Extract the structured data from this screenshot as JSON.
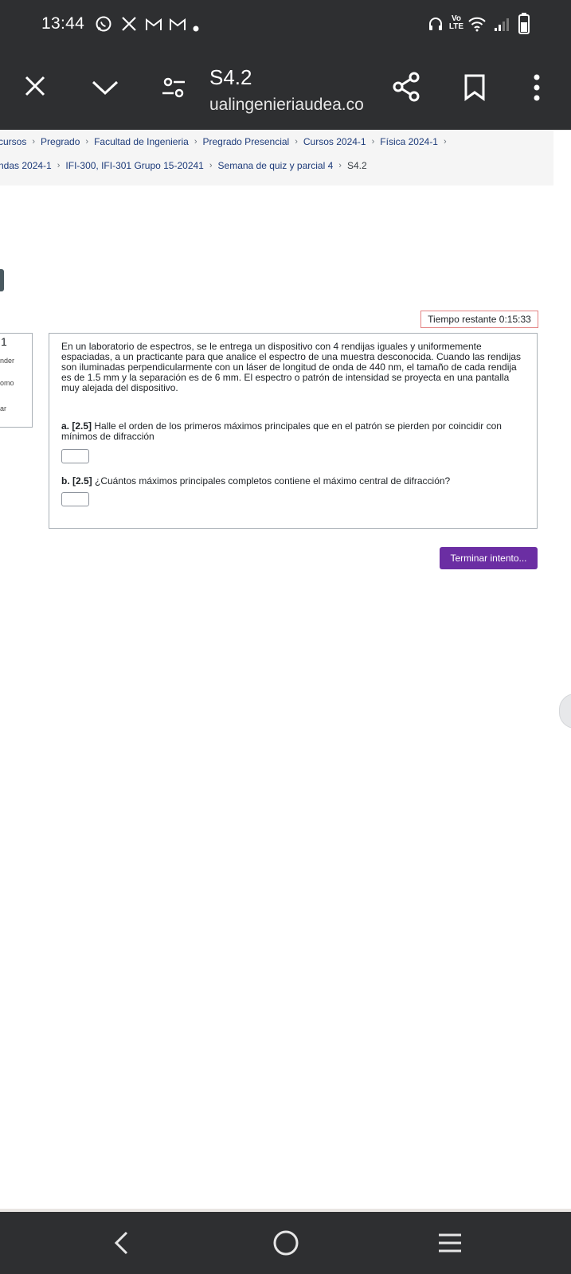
{
  "status_bar": {
    "time": "13:44",
    "left_icons": [
      "whatsapp-icon",
      "x-icon",
      "gmail-icon",
      "gmail-icon",
      "dot-icon"
    ],
    "right_icons": [
      "headphones-icon",
      "volte-icon",
      "wifi-icon",
      "signal-icon",
      "battery-icon"
    ],
    "volte_top": "Vo",
    "volte_bottom": "LTE"
  },
  "browser": {
    "title": "S4.2",
    "url": "ualingenieriaudea.co",
    "icons": [
      "close-icon",
      "chevron-down-icon",
      "settings-toggle-icon",
      "share-icon",
      "bookmark-icon",
      "more-icon"
    ]
  },
  "breadcrumb": {
    "line1": [
      "cursos",
      "Pregrado",
      "Facultad de Ingenieria",
      "Pregrado Presencial",
      "Cursos 2024-1",
      "Física 2024-1"
    ],
    "line2": [
      "ndas 2024-1",
      "IFI-300, IFI-301 Grupo 15-20241",
      "Semana de quiz y parcial 4"
    ],
    "current": "S4.2"
  },
  "timer": {
    "label": "Tiempo restante 0:15:33"
  },
  "question_info": {
    "number": "1",
    "line1": "nder",
    "line2": "omo",
    "line3": "ar"
  },
  "question": {
    "text": "En un laboratorio de espectros, se le entrega un dispositivo con 4 rendijas iguales y uniformemente espaciadas, a un practicante para que analice el espectro de una muestra desconocida. Cuando las rendijas son iluminadas perpendicularmente con un láser de longitud de onda de 440 nm, el tamaño de cada rendija es de 1.5 mm y la separación es de 6 mm. El espectro o patrón de intensidad se proyecta en una pantalla muy alejada del dispositivo.",
    "part_a_prefix": "a. [2.5]",
    "part_a_text": " Halle el orden de los primeros máximos principales que en el patrón se pierden por coincidir con mínimos de difracción",
    "part_a_value": "",
    "part_b_prefix": "b. [2.5]",
    "part_b_text": " ¿Cuántos máximos principales completos contiene el máximo central de difracción?",
    "part_b_value": ""
  },
  "actions": {
    "finish_label": "Terminar intento..."
  },
  "nav_bar": {
    "icons": [
      "back-icon",
      "home-icon",
      "recents-icon"
    ]
  },
  "colors": {
    "system_bar": "#2e2f31",
    "link": "#1d3b7a",
    "finish_button": "#6b2ea3",
    "timer_border": "#e38383"
  }
}
